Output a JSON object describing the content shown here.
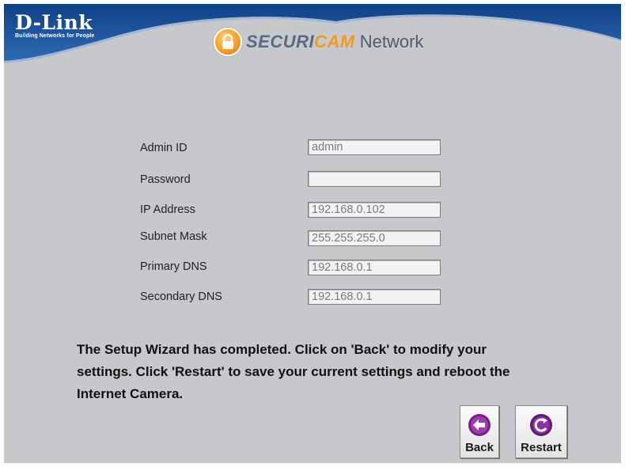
{
  "header": {
    "brand": "D-Link",
    "tagline": "Building Networks for People",
    "product_primary": "SECURI",
    "product_accent": "CAM",
    "product_suffix": "Network"
  },
  "icons": {
    "lock": "lock-icon",
    "back": "back-arrow-icon",
    "restart": "restart-icon"
  },
  "colors": {
    "header_blue": "#1c4c8c",
    "panel_gray": "#c7c8cb",
    "accent_orange": "#f39a1e",
    "button_purple": "#7a1f86"
  },
  "form": {
    "admin_id": {
      "label": "Admin ID",
      "value": "admin"
    },
    "password": {
      "label": "Password",
      "value": ""
    },
    "ip_address": {
      "label": "IP Address",
      "value": "192.168.0.102"
    },
    "subnet_mask": {
      "label": "Subnet Mask",
      "value": "255.255.255.0"
    },
    "primary_dns": {
      "label": "Primary DNS",
      "value": "192.168.0.1"
    },
    "secondary_dns": {
      "label": "Secondary DNS",
      "value": "192.168.0.1"
    }
  },
  "message": "The Setup Wizard has completed. Click on 'Back' to modify your settings. Click 'Restart' to save your current settings and reboot the Internet Camera.",
  "buttons": {
    "back": "Back",
    "restart": "Restart"
  }
}
